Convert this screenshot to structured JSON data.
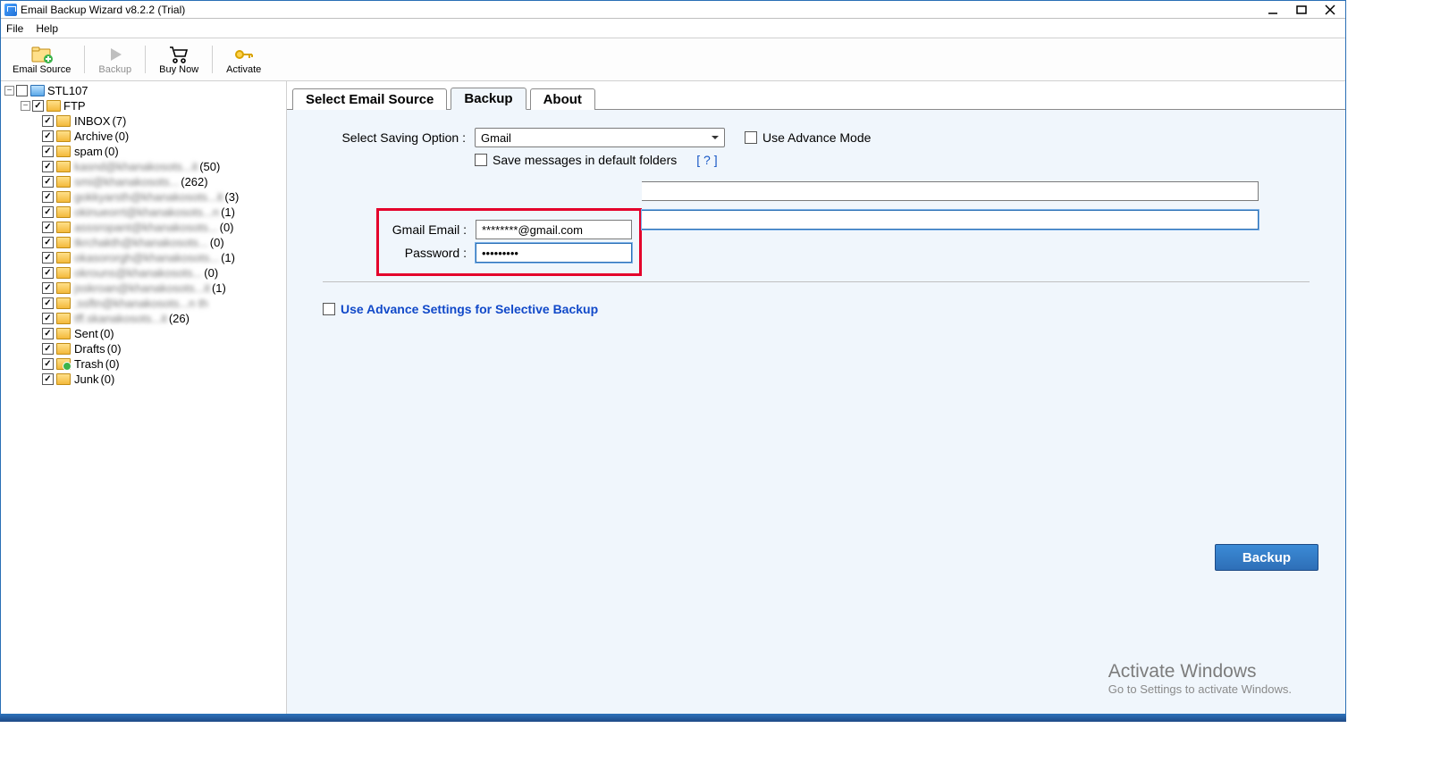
{
  "window": {
    "title": "Email Backup Wizard v8.2.2 (Trial)"
  },
  "menu": {
    "file": "File",
    "help": "Help"
  },
  "toolbar": {
    "emailSource": "Email Source",
    "backup": "Backup",
    "buyNow": "Buy Now",
    "activate": "Activate"
  },
  "tree": {
    "root": "STL107",
    "ftp": "FTP",
    "items": [
      {
        "label": "INBOX",
        "count": "(7)",
        "blur": false,
        "special": false
      },
      {
        "label": "Archive",
        "count": "(0)",
        "blur": false,
        "special": false
      },
      {
        "label": "spam",
        "count": "(0)",
        "blur": false,
        "special": false
      },
      {
        "label": "kasnd@khanakosots...it",
        "count": "(50)",
        "blur": true,
        "special": false
      },
      {
        "label": "smi@khanakosots...",
        "count": "(262)",
        "blur": true,
        "special": false
      },
      {
        "label": "gokkyarsth@khanakosots...it",
        "count": "(3)",
        "blur": true,
        "special": false
      },
      {
        "label": "okinueorrt@khanakosots...n",
        "count": "(1)",
        "blur": true,
        "special": false
      },
      {
        "label": "asssropant@khanakosots...",
        "count": "(0)",
        "blur": true,
        "special": false
      },
      {
        "label": "tkrchakth@khanakosots...",
        "count": "(0)",
        "blur": true,
        "special": false
      },
      {
        "label": "okasororgh@khanakosots...",
        "count": "(1)",
        "blur": true,
        "special": false
      },
      {
        "label": "okrouns@khanakosots...",
        "count": "(0)",
        "blur": true,
        "special": false
      },
      {
        "label": "jsskroan@khanakosots...it",
        "count": "(1)",
        "blur": true,
        "special": false
      },
      {
        "label": ";ssftn@khanakosots...n th",
        "count": "",
        "blur": true,
        "special": false
      },
      {
        "label": "tff.skanakosots...it",
        "count": "(26)",
        "blur": true,
        "special": false
      },
      {
        "label": "Sent",
        "count": "(0)",
        "blur": false,
        "special": false
      },
      {
        "label": "Drafts",
        "count": "(0)",
        "blur": false,
        "special": false
      },
      {
        "label": "Trash",
        "count": "(0)",
        "blur": false,
        "special": true
      },
      {
        "label": "Junk",
        "count": "(0)",
        "blur": false,
        "special": false
      }
    ]
  },
  "tabs": {
    "selectSource": "Select Email Source",
    "backup": "Backup",
    "about": "About"
  },
  "backupTab": {
    "savingOptionLabel": "Select Saving Option :",
    "savingOptionValue": "Gmail",
    "useAdvanceMode": "Use Advance Mode",
    "saveDefault": "Save messages in default folders",
    "helpLink": "[ ? ]",
    "emailLabel": "Gmail Email  :",
    "emailValue": "********@gmail.com",
    "passwordLabel": "Password  :",
    "passwordValue": "•••••••••",
    "advSettings": "Use Advance Settings for Selective Backup",
    "backupBtn": "Backup"
  },
  "watermark": {
    "line1": "Activate Windows",
    "line2": "Go to Settings to activate Windows."
  }
}
